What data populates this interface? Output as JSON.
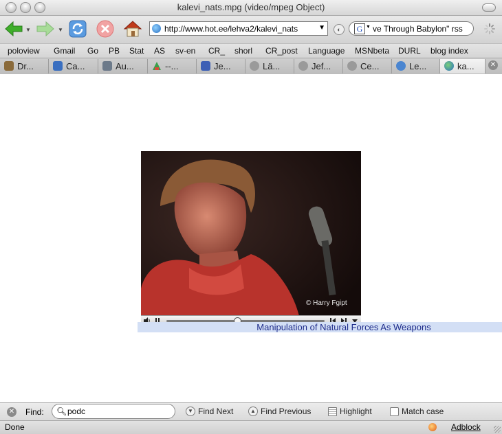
{
  "window": {
    "title": "kalevi_nats.mpg (video/mpeg Object)"
  },
  "toolbar": {
    "back_icon": "back-arrow-icon",
    "forward_icon": "forward-arrow-icon",
    "reload_icon": "reload-icon",
    "stop_icon": "stop-icon",
    "home_icon": "home-icon",
    "url": "http://www.hot.ee/lehva2/kalevi_nats",
    "search_engine": "G",
    "search_text": "ve Through Babylon\" rss"
  },
  "bookmarks": [
    "poloview",
    "Gmail",
    "Go",
    "PB",
    "Stat",
    "AS",
    "sv-en",
    "CR_",
    "shorl",
    "CR_post",
    "Language",
    "MSNbeta",
    "DURL",
    "blog index"
  ],
  "tabs": [
    {
      "label": "Dr...",
      "icon": "dr-favicon",
      "color": "#8a6a3a"
    },
    {
      "label": "Ca...",
      "icon": "ca-favicon",
      "color": "#3a6fc0"
    },
    {
      "label": "Au...",
      "icon": "as-favicon",
      "color": "#6c7a8a"
    },
    {
      "label": "--...",
      "icon": "triangle-favicon",
      "color": "#3aa04a"
    },
    {
      "label": "Je...",
      "icon": "je-favicon",
      "color": "#3d5fb5"
    },
    {
      "label": "Lä...",
      "icon": "globe-grey-icon",
      "color": "#9a9a9a"
    },
    {
      "label": "Jef...",
      "icon": "globe-grey-icon",
      "color": "#9a9a9a"
    },
    {
      "label": "Ce...",
      "icon": "globe-grey-icon",
      "color": "#9a9a9a"
    },
    {
      "label": "Le...",
      "icon": "globe-blue-icon",
      "color": "#4a85d0"
    },
    {
      "label": "ka...",
      "icon": "globe-icon",
      "color": "#3d8a3d"
    }
  ],
  "video": {
    "watermark": "© Harry Fgipt",
    "progress": 0.45
  },
  "caption": "Manipulation of Natural Forces As Weapons",
  "findbar": {
    "label": "Find:",
    "query": "podc",
    "find_next": "Find Next",
    "find_previous": "Find Previous",
    "highlight": "Highlight",
    "match_case": "Match case"
  },
  "statusbar": {
    "status": "Done",
    "adblock": "Adblock"
  },
  "colors": {
    "caption_bg": "#d3dff5",
    "caption_text": "#1d2b8a",
    "back_green": "#3fae2a"
  }
}
